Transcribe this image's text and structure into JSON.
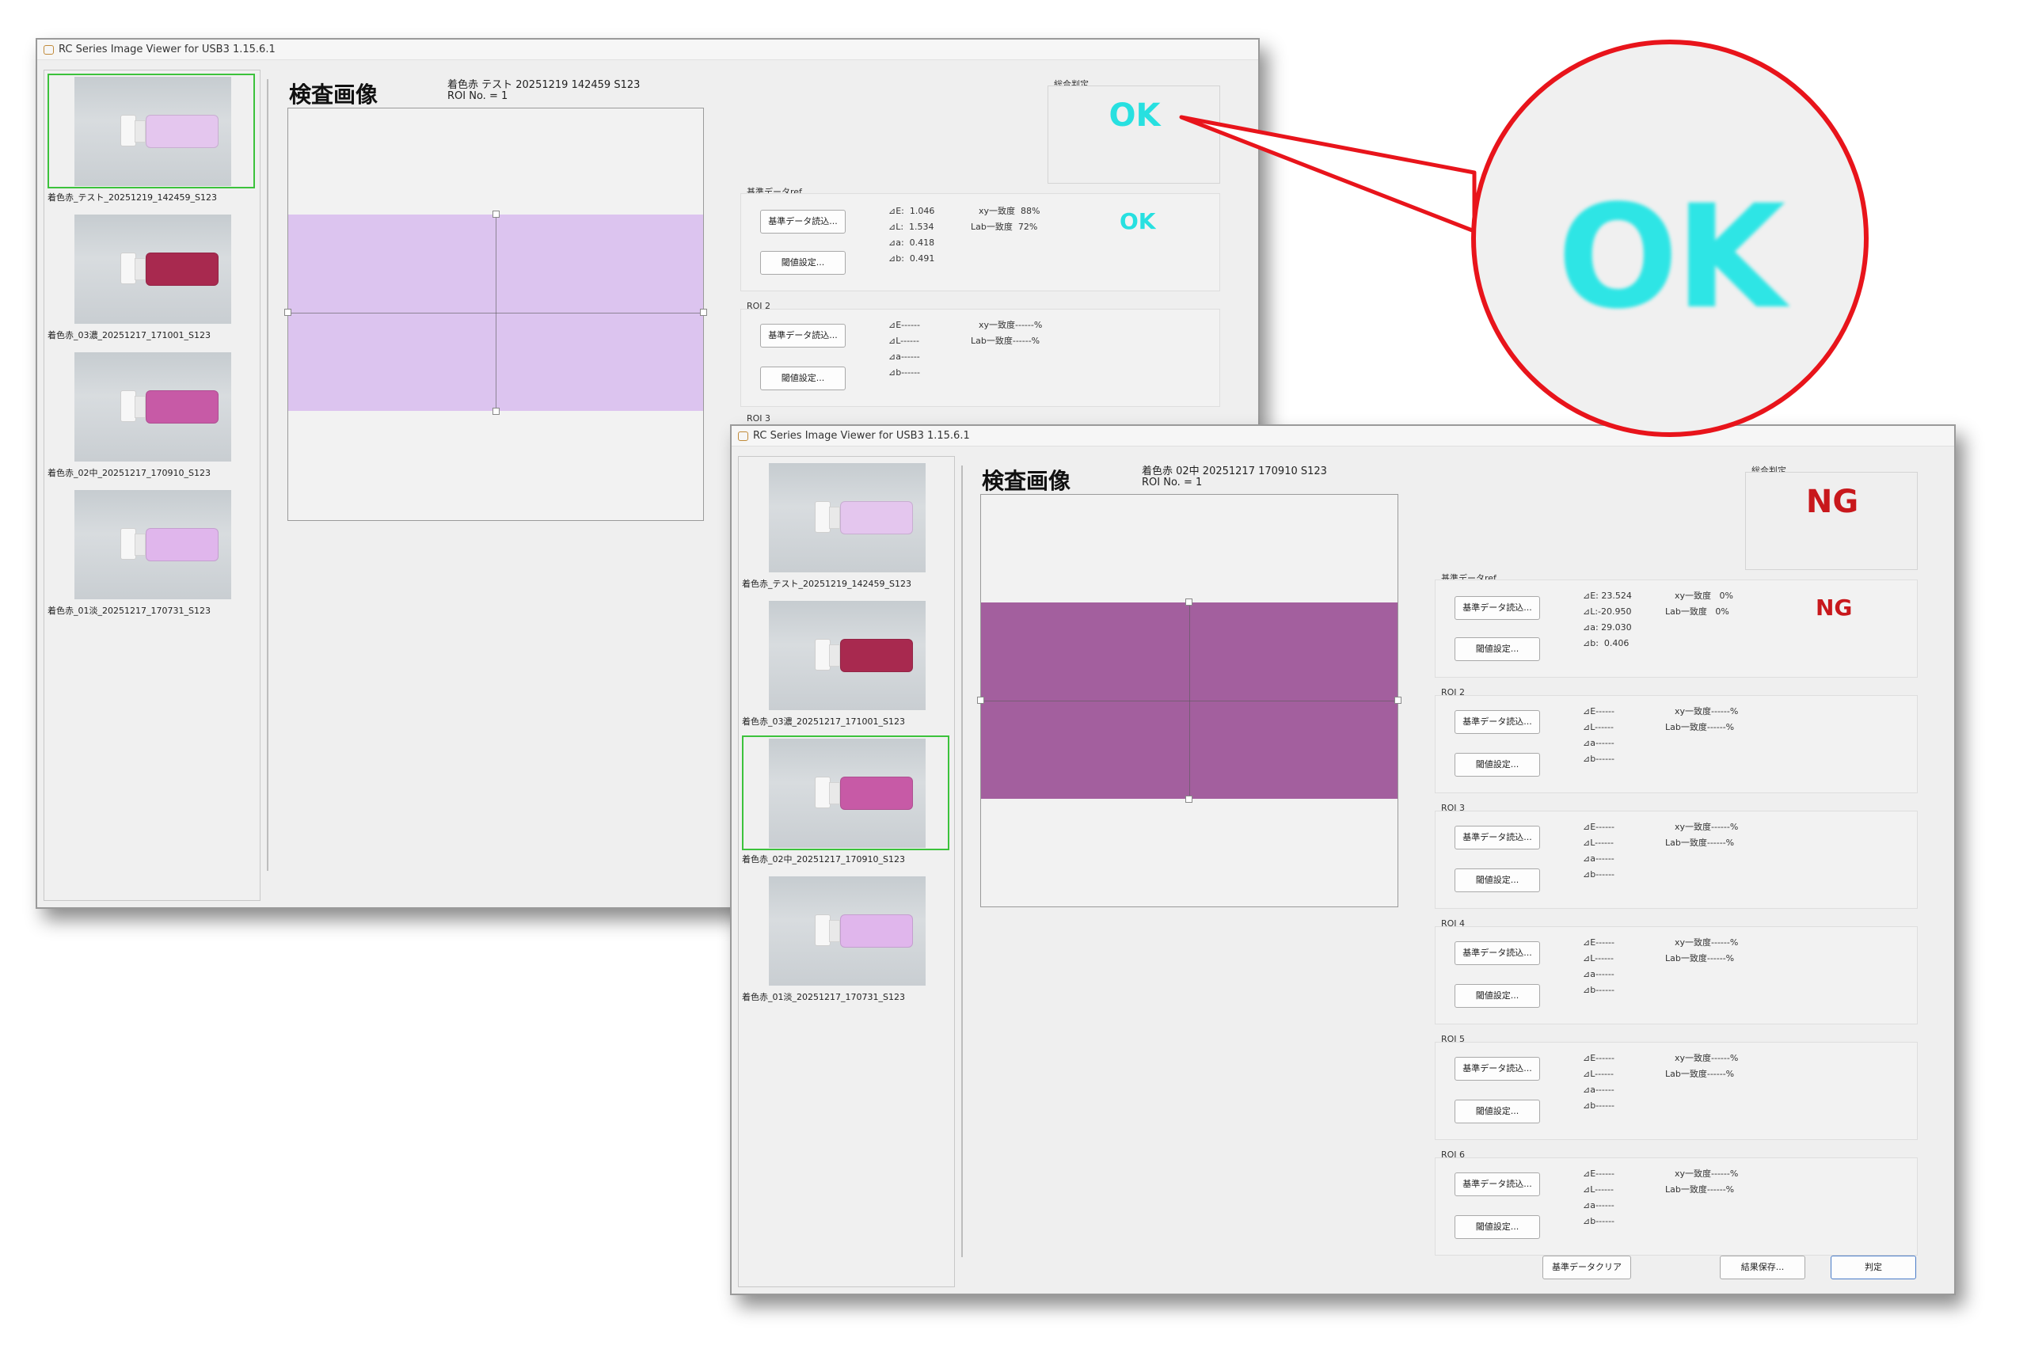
{
  "colors": {
    "ok": "#27e0e0",
    "ng": "#c8181c",
    "callout": "#e8141b",
    "selection": "#3cc23c",
    "roi_light": "#dcc4ef",
    "roi_dark": "#a35f9e"
  },
  "window1": {
    "title": "RC Series Image Viewer for USB3 1.15.6.1",
    "main_title": "検査画像",
    "image_name": "着色赤 テスト  20251219  142459  S123",
    "roi_no": "ROI No. = 1",
    "overall_label": "総合判定",
    "overall_verdict": "OK",
    "thumbnails": [
      {
        "label": "着色赤_テスト_20251219_142459_S123",
        "tone": "#e4c6ee",
        "selected": true
      },
      {
        "label": "着色赤_03濃_20251217_171001_S123",
        "tone": "#a8294f",
        "selected": false
      },
      {
        "label": "着色赤_02中_20251217_170910_S123",
        "tone": "#c75aa6",
        "selected": false
      },
      {
        "label": "着色赤_01淡_20251217_170731_S123",
        "tone": "#e0b6ec",
        "selected": false
      }
    ],
    "ref_group": {
      "label": "基準データref",
      "load_button": "基準データ読込...",
      "threshold_button": "閾値設定...",
      "dE": "⊿E:  1.046",
      "dL": "⊿L:  1.534",
      "da": "⊿a:  0.418",
      "db": "⊿b:  0.491",
      "xy": "xy一致度  88%",
      "lab": "Lab一致度  72%",
      "verdict": "OK"
    },
    "roi2": {
      "label": "ROI 2",
      "load_button": "基準データ読込...",
      "threshold_button": "閾値設定...",
      "dE": "⊿E------",
      "dL": "⊿L------",
      "da": "⊿a------",
      "db": "⊿b------",
      "xy": "xy一致度------%",
      "lab": "Lab一致度------%"
    },
    "roi3_label": "ROI 3"
  },
  "window2": {
    "title": "RC Series Image Viewer for USB3 1.15.6.1",
    "main_title": "検査画像",
    "image_name": "着色赤  02中  20251217  170910  S123",
    "roi_no": "ROI No. = 1",
    "overall_label": "総合判定",
    "overall_verdict": "NG",
    "thumbnails": [
      {
        "label": "着色赤_テスト_20251219_142459_S123",
        "tone": "#e4c6ee",
        "selected": false
      },
      {
        "label": "着色赤_03濃_20251217_171001_S123",
        "tone": "#a8294f",
        "selected": false
      },
      {
        "label": "着色赤_02中_20251217_170910_S123",
        "tone": "#c75aa6",
        "selected": true
      },
      {
        "label": "着色赤_01淡_20251217_170731_S123",
        "tone": "#e0b6ec",
        "selected": false
      }
    ],
    "ref_group": {
      "label": "基準データref",
      "load_button": "基準データ読込...",
      "threshold_button": "閾値設定...",
      "dE": "⊿E: 23.524",
      "dL": "⊿L:-20.950",
      "da": "⊿a: 29.030",
      "db": "⊿b:  0.406",
      "xy": "xy一致度   0%",
      "lab": "Lab一致度   0%",
      "verdict": "NG"
    },
    "rois": [
      {
        "label": "ROI 2",
        "load_button": "基準データ読込...",
        "threshold_button": "閾値設定...",
        "dE": "⊿E------",
        "dL": "⊿L------",
        "da": "⊿a------",
        "db": "⊿b------",
        "xy": "xy一致度------%",
        "lab": "Lab一致度------%"
      },
      {
        "label": "ROI 3",
        "load_button": "基準データ読込...",
        "threshold_button": "閾値設定...",
        "dE": "⊿E------",
        "dL": "⊿L------",
        "da": "⊿a------",
        "db": "⊿b------",
        "xy": "xy一致度------%",
        "lab": "Lab一致度------%"
      },
      {
        "label": "ROI 4",
        "load_button": "基準データ読込...",
        "threshold_button": "閾値設定...",
        "dE": "⊿E------",
        "dL": "⊿L------",
        "da": "⊿a------",
        "db": "⊿b------",
        "xy": "xy一致度------%",
        "lab": "Lab一致度------%"
      },
      {
        "label": "ROI 5",
        "load_button": "基準データ読込...",
        "threshold_button": "閾値設定...",
        "dE": "⊿E------",
        "dL": "⊿L------",
        "da": "⊿a------",
        "db": "⊿b------",
        "xy": "xy一致度------%",
        "lab": "Lab一致度------%"
      },
      {
        "label": "ROI 6",
        "load_button": "基準データ読込...",
        "threshold_button": "閾値設定...",
        "dE": "⊿E------",
        "dL": "⊿L------",
        "da": "⊿a------",
        "db": "⊿b------",
        "xy": "xy一致度------%",
        "lab": "Lab一致度------%"
      }
    ],
    "bottom_buttons": {
      "clear": "基準データクリア",
      "save": "結果保存...",
      "judge": "判定"
    }
  },
  "zoom_callout": {
    "text": "OK"
  }
}
